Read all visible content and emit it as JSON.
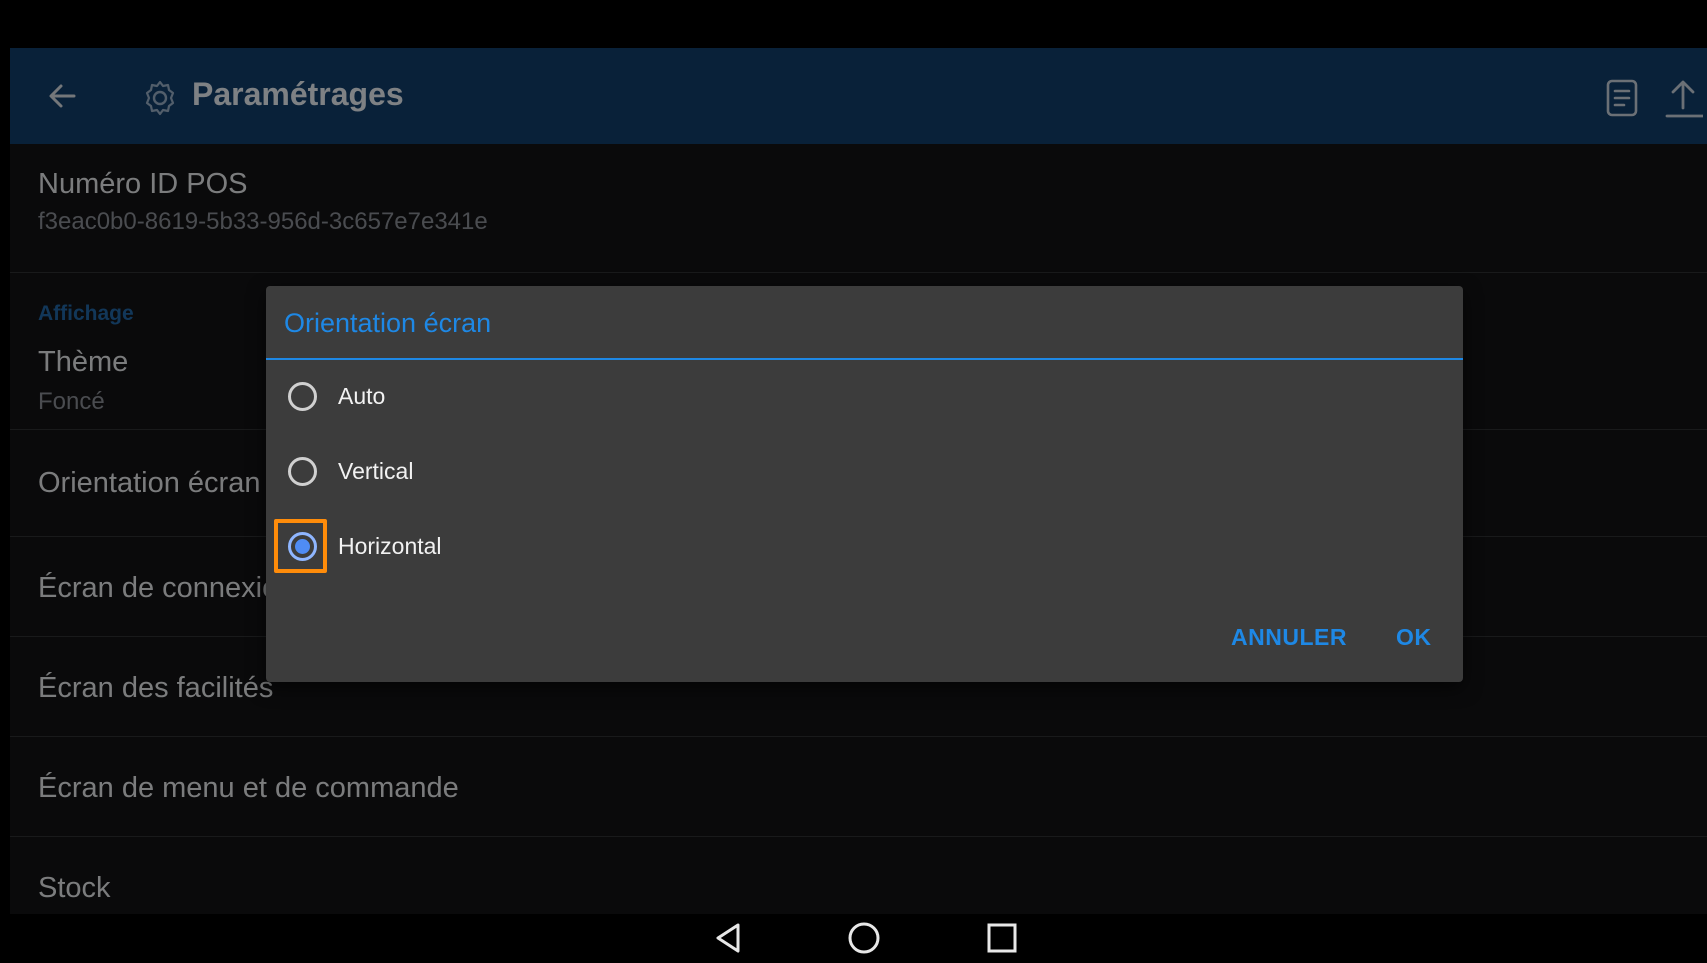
{
  "appbar": {
    "title": "Paramétrages",
    "icons": [
      "back-arrow-icon",
      "gear-icon",
      "document-icon",
      "upload-icon"
    ]
  },
  "settings": {
    "pos_id": {
      "title": "Numéro ID POS",
      "value": "f3eac0b0-8619-5b33-956d-3c657e7e341e"
    },
    "section_display": "Affichage",
    "theme": {
      "title": "Thème",
      "value": "Foncé"
    },
    "orientation": {
      "title": "Orientation écran"
    },
    "login_screen": {
      "title": "Écran de connexion"
    },
    "facilities_screen": {
      "title": "Écran des facilités"
    },
    "menu_screen": {
      "title": "Écran de menu et de commande"
    },
    "stock": {
      "title": "Stock"
    }
  },
  "dialog": {
    "title": "Orientation écran",
    "options": [
      {
        "label": "Auto",
        "selected": false
      },
      {
        "label": "Vertical",
        "selected": false
      },
      {
        "label": "Horizontal",
        "selected": true
      }
    ],
    "cancel_label": "ANNULER",
    "ok_label": "OK"
  },
  "colors": {
    "appbar": "#113a63",
    "accent": "#1e88e5",
    "highlight": "#ff8c0a",
    "radio_selected": "#4f8cf5"
  },
  "navbar": {
    "icons": [
      "nav-back-icon",
      "nav-home-icon",
      "nav-recents-icon"
    ]
  }
}
